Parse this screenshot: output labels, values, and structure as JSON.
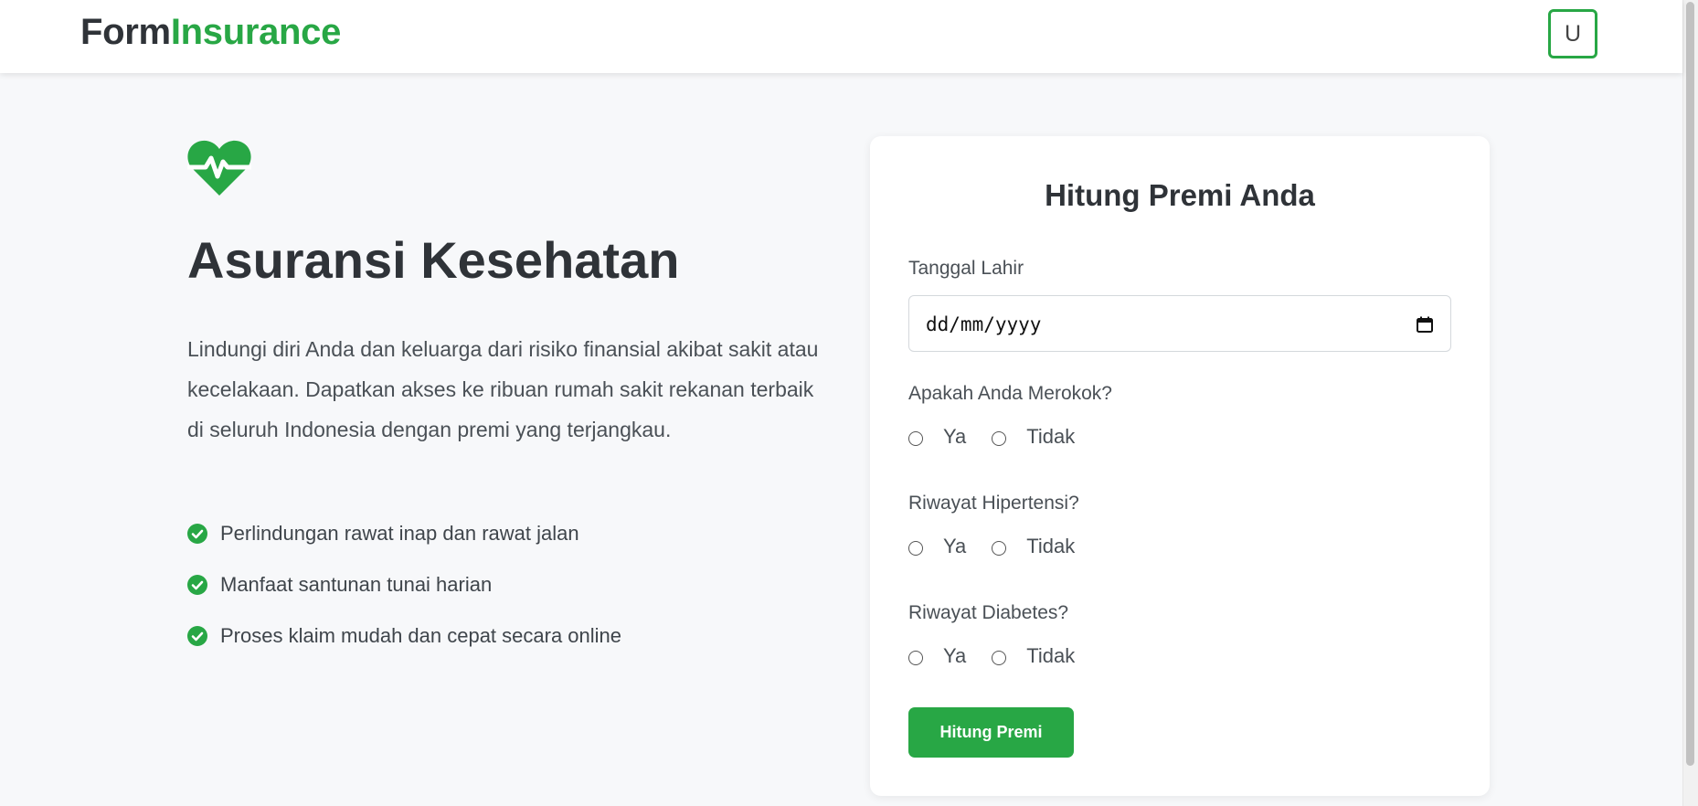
{
  "brand": {
    "part1": "Form",
    "part2": "Insurance",
    "accent_color": "#28a745"
  },
  "user_menu": {
    "initial": "U"
  },
  "hero": {
    "icon": "heart-pulse-icon",
    "title": "Asuransi Kesehatan",
    "description": "Lindungi diri Anda dan keluarga dari risiko finansial akibat sakit atau kecelakaan. Dapatkan akses ke ribuan rumah sakit rekanan terbaik di seluruh Indonesia dengan premi yang terjangkau.",
    "features": [
      {
        "icon": "check-circle-icon",
        "label": "Perlindungan rawat inap dan rawat jalan"
      },
      {
        "icon": "check-circle-icon",
        "label": "Manfaat santunan tunai harian"
      },
      {
        "icon": "check-circle-icon",
        "label": "Proses klaim mudah dan cepat secara online"
      }
    ]
  },
  "form": {
    "title": "Hitung Premi Anda",
    "birthdate": {
      "label": "Tanggal Lahir",
      "placeholder": "dd/mm/yyyy",
      "icon": "calendar-icon"
    },
    "questions": [
      {
        "label": "Apakah Anda Merokok?",
        "options": [
          "Ya",
          "Tidak"
        ]
      },
      {
        "label": "Riwayat Hipertensi?",
        "options": [
          "Ya",
          "Tidak"
        ]
      },
      {
        "label": "Riwayat Diabetes?",
        "options": [
          "Ya",
          "Tidak"
        ]
      }
    ],
    "submit_label": "Hitung Premi"
  }
}
